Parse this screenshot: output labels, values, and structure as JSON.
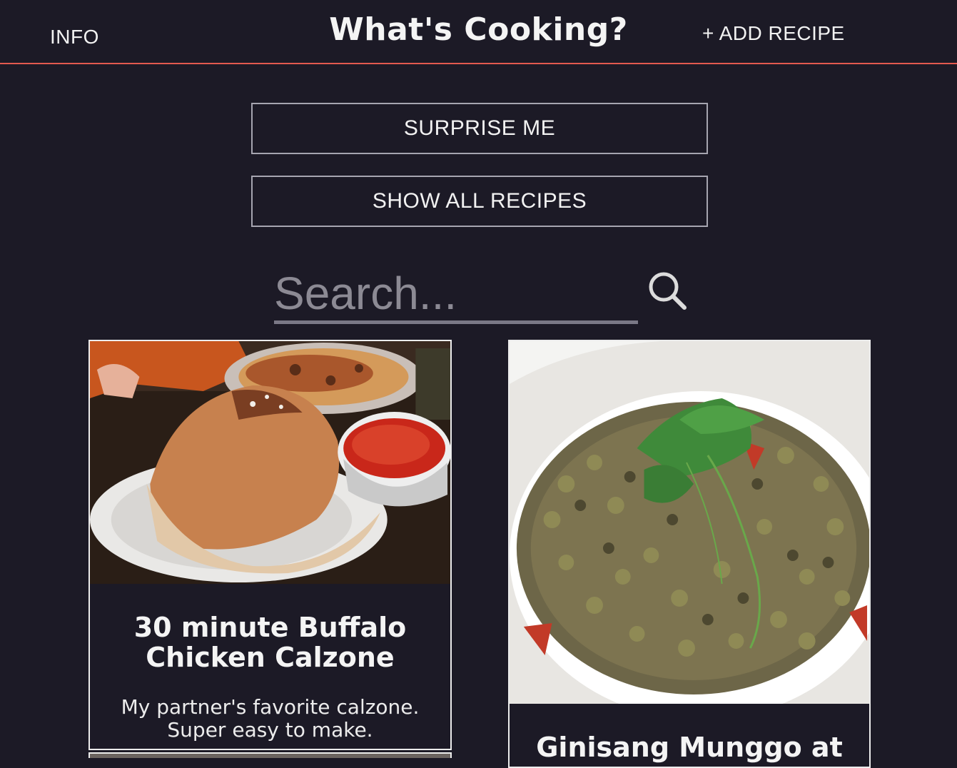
{
  "header": {
    "info_label": "INFO",
    "title": "What's Cooking?",
    "add_recipe_label": "+ ADD RECIPE"
  },
  "actions": {
    "surprise_label": "SURPRISE ME",
    "show_all_label": "SHOW ALL RECIPES"
  },
  "search": {
    "placeholder": "Search...",
    "icon": "search-icon"
  },
  "recipes": [
    {
      "title": "30 minute Buffalo Chicken Calzone",
      "description": "My partner's favorite calzone. Super easy to make.",
      "image": "calzone-photo"
    },
    {
      "title": "Ginisang Munggo at",
      "description": "",
      "image": "mung-bean-stew-photo"
    }
  ],
  "colors": {
    "background": "#1c1a26",
    "header_rule": "#e35a4f",
    "button_border": "#a6a5b0",
    "text": "#f2f2f2"
  }
}
